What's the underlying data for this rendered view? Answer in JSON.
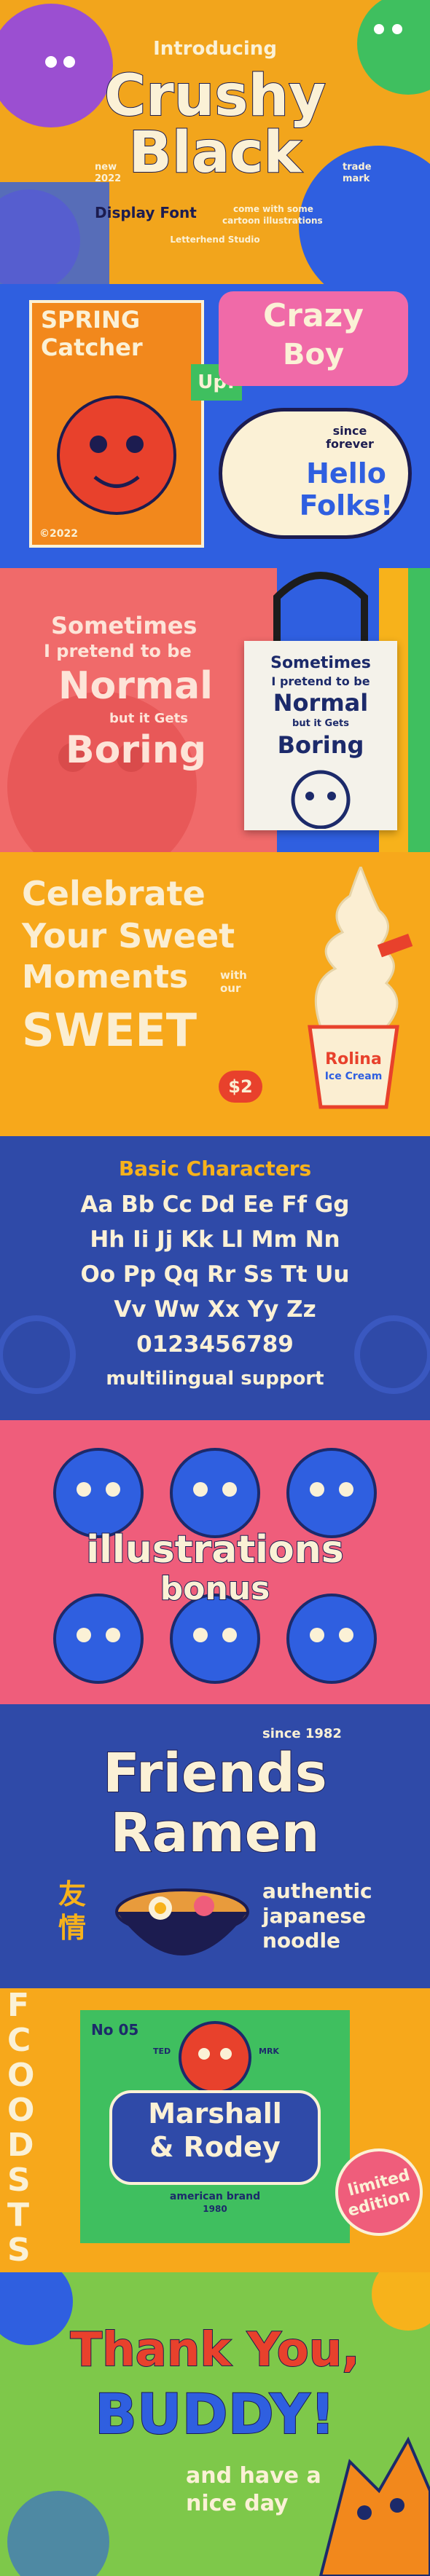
{
  "s1": {
    "intro": "Introducing",
    "title1": "Crushy",
    "title2": "Black",
    "left_tag_1": "new",
    "left_tag_2": "2022",
    "right_tag_1": "trade",
    "right_tag_2": "mark",
    "subtitle": "Display Font",
    "note_1": "come with some",
    "note_2": "cartoon illustrations",
    "studio": "Letterhend Studio",
    "colors": {
      "bg": "#f2a51c",
      "purple": "#9b4fd1",
      "blue": "#2f5fe0",
      "cream": "#fbf1d6",
      "navy": "#1c1c50",
      "green": "#3fbf5f",
      "pink": "#f05b8c"
    }
  },
  "s2": {
    "spring_1": "SPRING",
    "spring_2": "Catcher",
    "up": "Up!",
    "crazy_1": "Crazy",
    "crazy_2": "Boy",
    "year": "©2022",
    "since_1": "since",
    "since_2": "forever",
    "hello_1": "Hello",
    "hello_2": "Folks!",
    "colors": {
      "bg": "#2f5fe0",
      "orange": "#f2881c",
      "red": "#e8412c",
      "pink": "#f06aa8",
      "cream": "#fbf1d6"
    }
  },
  "s3": {
    "line1": "Sometimes",
    "line2": "I pretend to be",
    "line3": "Normal",
    "line4": "but it Gets",
    "line5": "Boring",
    "bag_1": "Sometimes",
    "bag_2": "I pretend to be",
    "bag_3": "Normal",
    "bag_4": "but it Gets",
    "bag_5": "Boring",
    "colors": {
      "bg": "#f06a6a",
      "cream": "#fde4d8",
      "bag": "#f4f2ea",
      "navy": "#1c2a6a"
    }
  },
  "s4": {
    "line1": "Celebrate",
    "line2": "Your Sweet",
    "line3": "Moments",
    "with": "with our",
    "line4": "SWEET",
    "price": "$2",
    "cup_1": "Rolina",
    "cup_2": "Ice Cream",
    "colors": {
      "bg": "#f7a81b",
      "cream": "#fbeed2",
      "red": "#e8412c",
      "blue": "#2f5fe0"
    }
  },
  "s5": {
    "heading": "Basic Characters",
    "row1": "Aa Bb Cc Dd Ee Ff Gg",
    "row2": "Hh Ii Jj Kk Ll Mm Nn",
    "row3": "Oo Pp Qq Rr Ss Tt Uu",
    "row4": "Vv Ww Xx Yy Zz",
    "digits": "0123456789",
    "multilingual": "multilingual support",
    "colors": {
      "bg": "#2f4aa8",
      "yellow": "#f7b21b",
      "cream": "#fbf1d6"
    }
  },
  "s6": {
    "line1": "illustrations",
    "line2": "bonus",
    "colors": {
      "bg": "#ef5d7b",
      "blue": "#2f5fe0",
      "cream": "#fbf1d6",
      "navy": "#1c2a6a"
    }
  },
  "s7": {
    "since": "since 1982",
    "line1": "Friends",
    "line2": "Ramen",
    "kanji_1": "友",
    "kanji_2": "情",
    "tag_1": "authentic",
    "tag_2": "japanese",
    "tag_3": "noodle",
    "colors": {
      "bg": "#2f4aa8",
      "cream": "#fbf1d6",
      "pink": "#ef5d7b",
      "yellow": "#f7b21b"
    }
  },
  "s8": {
    "side": "FCOODSTS",
    "no": "No 05",
    "ted": "TED",
    "mrk": "MRK",
    "line1": "Marshall",
    "line2": "& Rodey",
    "brand": "american brand",
    "year": "1980",
    "badge_1": "limited",
    "badge_2": "edition",
    "colors": {
      "bg": "#f7a81b",
      "green": "#3fbf5f",
      "blue": "#2f4aa8",
      "cream": "#fbf1d6",
      "pink": "#ef5d7b",
      "red": "#e8412c"
    }
  },
  "s9": {
    "line1": "Thank You,",
    "line2": "BUDDY!",
    "tag_1": "and have a",
    "tag_2": "nice day",
    "colors": {
      "bg": "#7ec84a",
      "red": "#e8412c",
      "blue": "#2f5fe0",
      "yellow": "#f7b21b",
      "navy": "#1c2a6a"
    }
  }
}
